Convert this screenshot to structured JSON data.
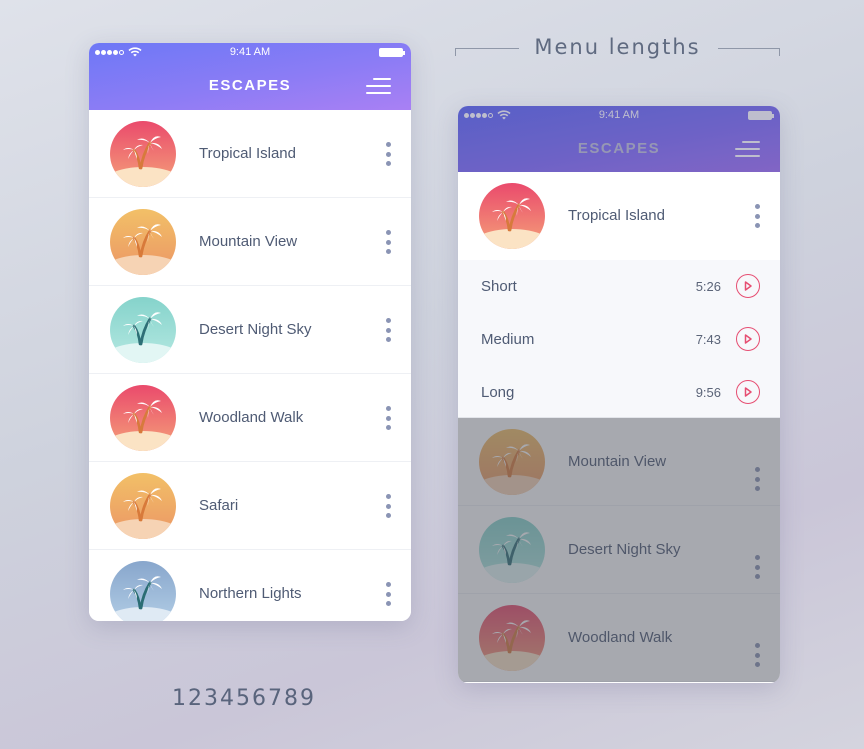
{
  "left_phone": {
    "status_bar": {
      "time": "9:41 AM",
      "signal_icon": "signal-dots-icon",
      "wifi_icon": "wifi-icon",
      "battery_icon": "battery-icon"
    },
    "header": {
      "title": "ESCAPES",
      "menu_icon": "hamburger-menu-icon"
    },
    "items": [
      {
        "label": "Tropical Island",
        "theme": "red"
      },
      {
        "label": "Mountain View",
        "theme": "orange"
      },
      {
        "label": "Desert Night Sky",
        "theme": "teal"
      },
      {
        "label": "Woodland Walk",
        "theme": "red"
      },
      {
        "label": "Safari",
        "theme": "orange"
      },
      {
        "label": "Northern Lights",
        "theme": "blue"
      }
    ]
  },
  "section_heading": "Menu lengths",
  "right_phone": {
    "status_bar": {
      "time": "9:41 AM"
    },
    "header": {
      "title": "ESCAPES"
    },
    "selected_item": {
      "label": "Tropical Island",
      "theme": "red"
    },
    "lengths": [
      {
        "label": "Short",
        "duration": "5:26"
      },
      {
        "label": "Medium",
        "duration": "7:43"
      },
      {
        "label": "Long",
        "duration": "9:56"
      }
    ],
    "dimmed_items": [
      {
        "label": "Mountain View",
        "theme": "orange"
      },
      {
        "label": "Desert Night Sky",
        "theme": "teal"
      },
      {
        "label": "Woodland Walk",
        "theme": "red"
      }
    ]
  },
  "number_sample": "123456789",
  "colors": {
    "header_start": "#6d78f6",
    "header_end": "#a980f4",
    "play_accent": "#e64e72",
    "text": "#4f5b74",
    "kebab": "#8a94b4"
  },
  "themes": {
    "red": {
      "top": "#ea4a6c",
      "mid": "#f28c76",
      "sand": "#fbe3c4",
      "trunk": "#d77a3c"
    },
    "orange": {
      "top": "#f2c067",
      "mid": "#eda066",
      "sand": "#f6d3b4",
      "trunk": "#d87a3a"
    },
    "teal": {
      "top": "#85d3cb",
      "mid": "#a9e3dc",
      "sand": "#e2f6f4",
      "trunk": "#2e6f76"
    },
    "blue": {
      "top": "#88a6cc",
      "mid": "#a9c5e0",
      "sand": "#dfeaf4",
      "trunk": "#2b6d74"
    }
  }
}
